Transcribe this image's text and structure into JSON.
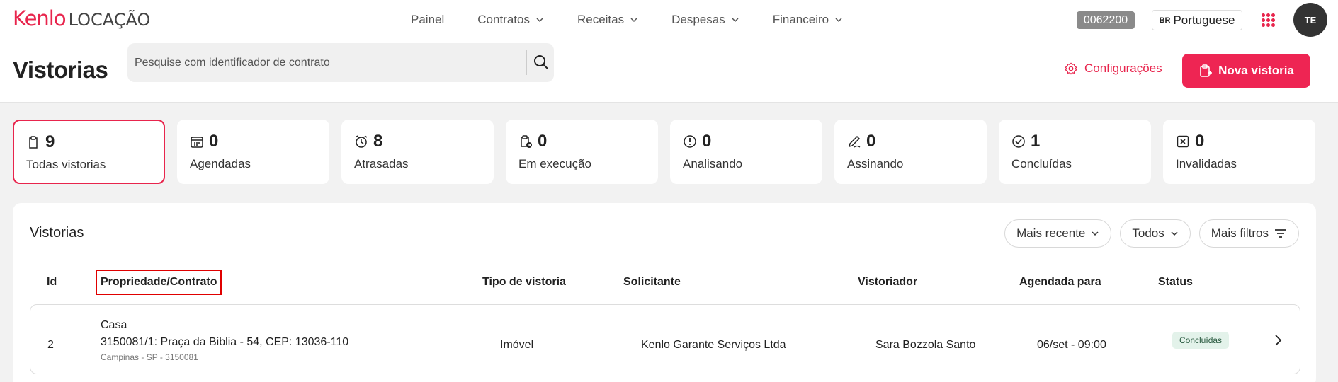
{
  "header": {
    "logo_brand": "Kenlo",
    "logo_product": "LOCAÇÃO",
    "nav": [
      {
        "label": "Painel",
        "dropdown": false
      },
      {
        "label": "Contratos",
        "dropdown": true
      },
      {
        "label": "Receitas",
        "dropdown": true
      },
      {
        "label": "Despesas",
        "dropdown": true
      },
      {
        "label": "Financeiro",
        "dropdown": true
      }
    ],
    "code": "0062200",
    "lang_flag": "BR",
    "lang": "Portuguese",
    "avatar": "TE"
  },
  "page": {
    "title": "Vistorias",
    "search_placeholder": "Pesquise com identificador de contrato",
    "config_label": "Configurações",
    "new_label": "Nova vistoria"
  },
  "cards": [
    {
      "count": "9",
      "label": "Todas vistorias",
      "icon": "clipboard-icon",
      "active": true
    },
    {
      "count": "0",
      "label": "Agendadas",
      "icon": "calendar-icon",
      "active": false
    },
    {
      "count": "8",
      "label": "Atrasadas",
      "icon": "alarm-clock-icon",
      "active": false
    },
    {
      "count": "0",
      "label": "Em execução",
      "icon": "clipboard-arrow-icon",
      "active": false
    },
    {
      "count": "0",
      "label": "Analisando",
      "icon": "info-circle-icon",
      "active": false
    },
    {
      "count": "0",
      "label": "Assinando",
      "icon": "pen-icon",
      "active": false
    },
    {
      "count": "1",
      "label": "Concluídas",
      "icon": "check-circle-icon",
      "active": false
    },
    {
      "count": "0",
      "label": "Invalidadas",
      "icon": "x-square-icon",
      "active": false
    }
  ],
  "table": {
    "title": "Vistorias",
    "filters": {
      "sort": "Mais recente",
      "scope": "Todos",
      "more": "Mais filtros"
    },
    "columns": {
      "id": "Id",
      "property": "Propriedade/Contrato",
      "type": "Tipo de vistoria",
      "requester": "Solicitante",
      "inspector": "Vistoriador",
      "scheduled": "Agendada para",
      "status": "Status"
    },
    "rows": [
      {
        "id": "2",
        "property_type": "Casa",
        "property_address": "3150081/1: Praça da Biblia - 54, CEP: 13036-110",
        "property_city": "Campinas - SP - 3150081",
        "type": "Imóvel",
        "requester": "Kenlo Garante Serviços Ltda",
        "inspector": "Sara Bozzola Santo",
        "scheduled": "06/set - 09:00",
        "status": "Concluídas"
      }
    ]
  },
  "colors": {
    "accent": "#e8254d",
    "status_done_bg": "#e3f2ea"
  }
}
